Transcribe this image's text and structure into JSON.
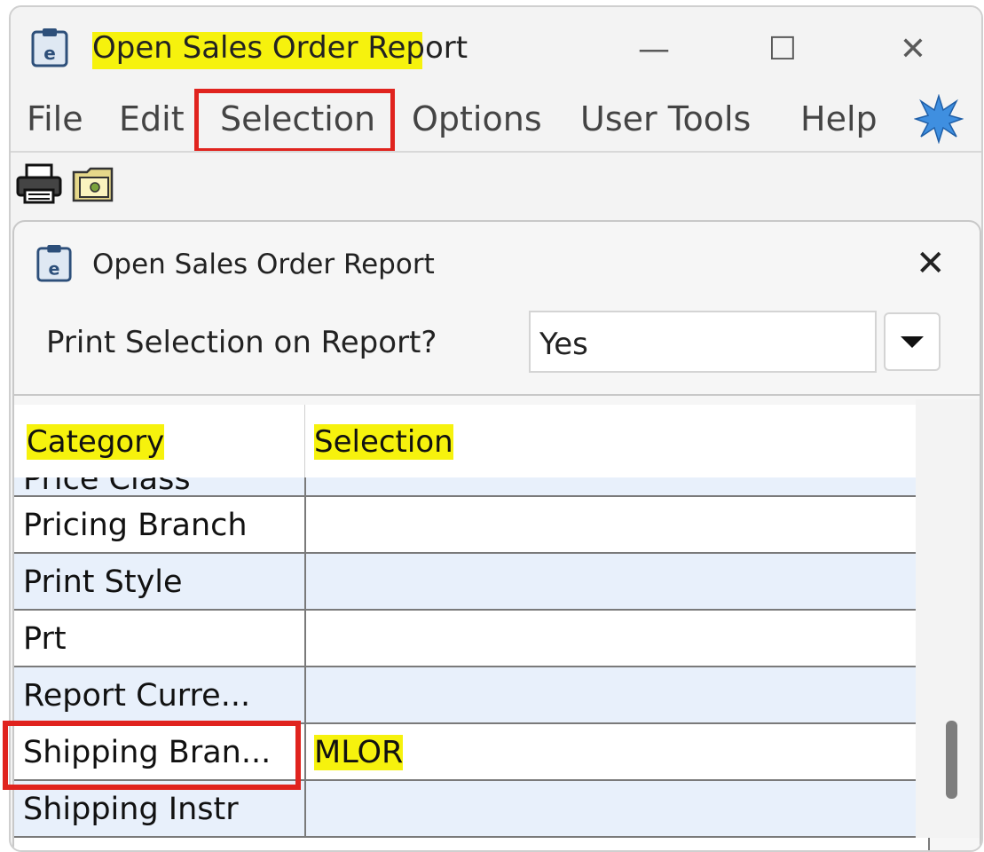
{
  "window": {
    "title": "Open Sales Order Report",
    "controls": {
      "minimize": "—",
      "maximize": "☐",
      "close": "✕"
    }
  },
  "menubar": {
    "items": [
      "File",
      "Edit",
      "Selection",
      "Options",
      "User Tools",
      "Help"
    ],
    "highlighted_item": "Selection"
  },
  "toolbar": {
    "icons": [
      "printer-icon",
      "folder-icon"
    ]
  },
  "dialog": {
    "title": "Open Sales Order Report",
    "close": "✕",
    "print_selection": {
      "label": "Print Selection on Report?",
      "value": "Yes"
    },
    "grid": {
      "headers": {
        "category": "Category",
        "selection": "Selection"
      },
      "partial_top_row": "Price Class",
      "rows": [
        {
          "category": "Pricing Branch",
          "selection": ""
        },
        {
          "category": "Print Style",
          "selection": ""
        },
        {
          "category": "Prt",
          "selection": ""
        },
        {
          "category": "Report Curre...",
          "selection": ""
        },
        {
          "category": "Shipping Bran...",
          "selection": "MLOR"
        },
        {
          "category": "Shipping Instr",
          "selection": ""
        }
      ]
    }
  },
  "colors": {
    "highlight": "#f6f20d",
    "annotation_red": "#e0231e",
    "row_alt": "#e8f0fb"
  }
}
